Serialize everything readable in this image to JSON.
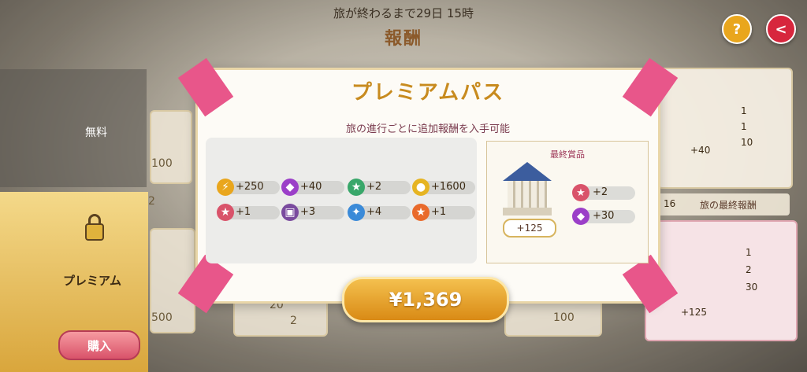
{
  "header": {
    "countdown": "旅が終わるまで29日 15時",
    "title": "報酬"
  },
  "buttons": {
    "help_glyph": "?",
    "back_glyph": "<"
  },
  "tiers": {
    "free_label": "無料",
    "premium_label": "プレミアム",
    "buy_label": "購入"
  },
  "background_cards": {
    "free_value": "100",
    "premium_left_value": "500",
    "premium_mid_values": [
      "20",
      "2"
    ],
    "premium_right_value": "100",
    "row_num": "2"
  },
  "modal": {
    "title": "プレミアムパス",
    "subtitle": "旅の進行ごとに追加報酬を入手可能",
    "rewards": [
      {
        "icon": "lightning-icon",
        "value": "+250",
        "color": "#e9a61d"
      },
      {
        "icon": "gem-icon",
        "value": "+40",
        "color": "#9b3fc8"
      },
      {
        "icon": "star-badge-icon",
        "value": "+2",
        "color": "#39a76a"
      },
      {
        "icon": "coin-icon",
        "value": "+1600",
        "color": "#e6b422"
      },
      {
        "icon": "star-badge-icon",
        "value": "+1",
        "color": "#d9536a"
      },
      {
        "icon": "ticket-icon",
        "value": "+3",
        "color": "#7a4b9e"
      },
      {
        "icon": "compass-icon",
        "value": "+4",
        "color": "#3a8ad8"
      },
      {
        "icon": "magic-star-icon",
        "value": "+1",
        "color": "#e96a2b"
      }
    ],
    "final_prize": {
      "title": "最終賞品",
      "cost": "+125",
      "items": [
        {
          "icon": "star-badge-icon",
          "value": "+2",
          "color": "#d9536a"
        },
        {
          "icon": "gem-icon",
          "value": "+30",
          "color": "#9b3fc8"
        }
      ]
    },
    "price": "¥1,369"
  },
  "right_panel": {
    "top": {
      "cost": "+40",
      "items": [
        "1",
        "1",
        "10"
      ]
    },
    "final_row": {
      "num": "16",
      "label": "旅の最終報酬"
    },
    "premium": {
      "cost": "+125",
      "items": [
        "1",
        "2",
        "30"
      ]
    }
  }
}
